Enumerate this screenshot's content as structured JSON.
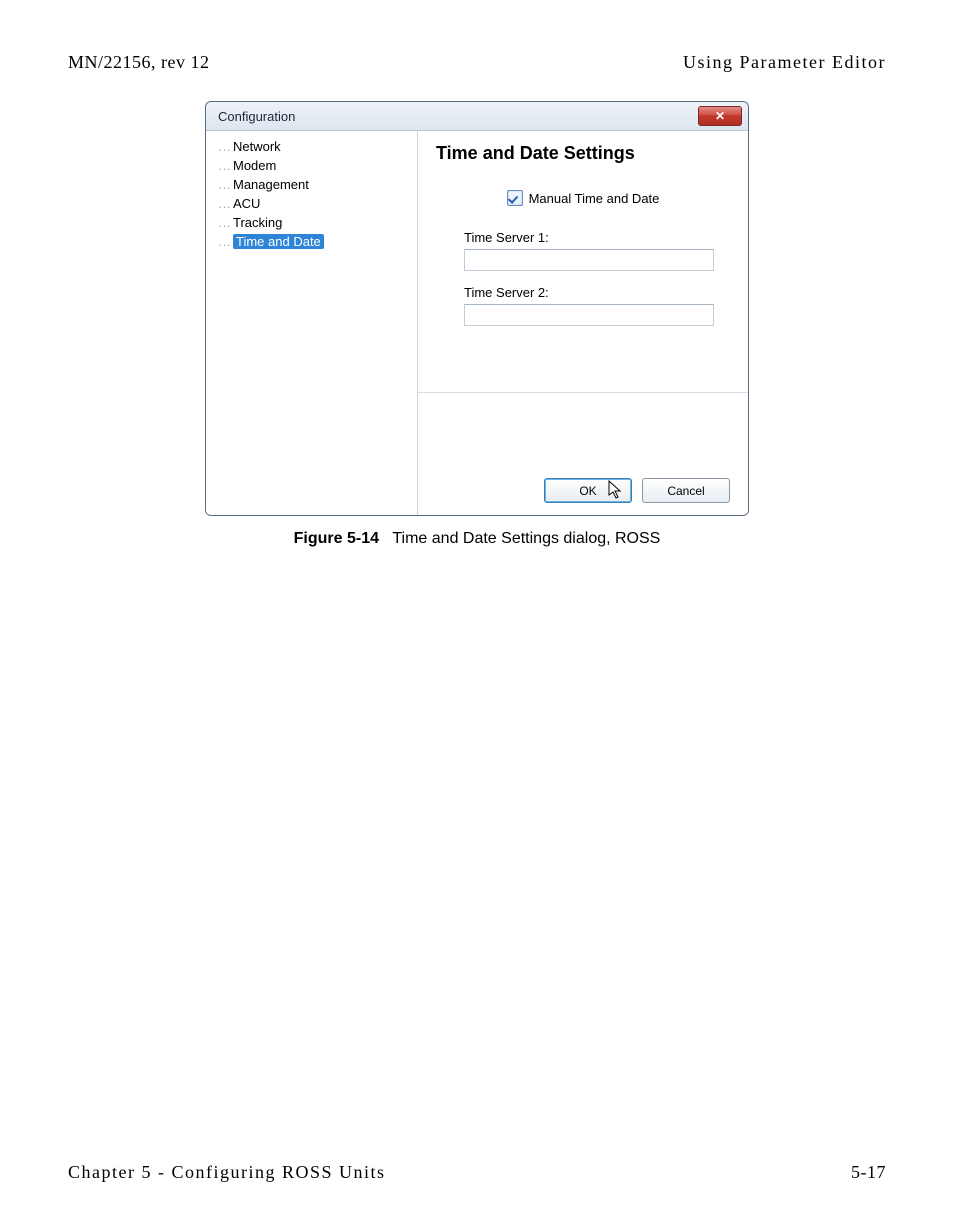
{
  "header": {
    "left": "MN/22156, rev 12",
    "right": "Using Parameter Editor"
  },
  "dialog": {
    "title": "Configuration",
    "close_glyph": "✕",
    "tree": {
      "items": [
        {
          "label": "Network",
          "selected": false
        },
        {
          "label": "Modem",
          "selected": false
        },
        {
          "label": "Management",
          "selected": false
        },
        {
          "label": "ACU",
          "selected": false
        },
        {
          "label": "Tracking",
          "selected": false
        },
        {
          "label": "Time and Date",
          "selected": true
        }
      ]
    },
    "content": {
      "title": "Time and Date Settings",
      "checkbox_label": "Manual Time and Date",
      "checkbox_checked": true,
      "time_server_1_label": "Time Server 1:",
      "time_server_1_value": "",
      "time_server_2_label": "Time Server 2:",
      "time_server_2_value": ""
    },
    "buttons": {
      "ok": "OK",
      "cancel": "Cancel"
    }
  },
  "figure_caption": {
    "label": "Figure 5-14",
    "text": "Time and Date Settings dialog, ROSS"
  },
  "footer": {
    "left": "Chapter 5 - Configuring ROSS Units",
    "right": "5-17"
  }
}
